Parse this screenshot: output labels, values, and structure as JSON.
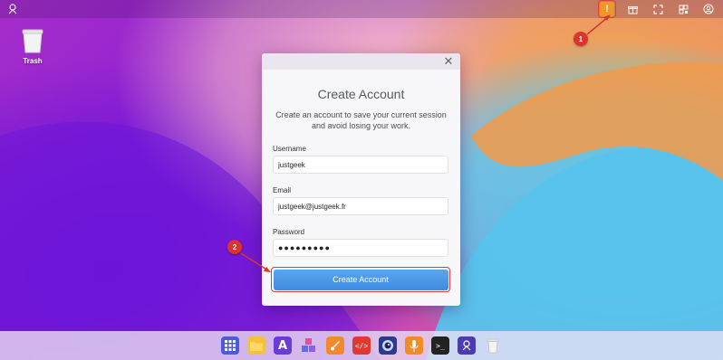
{
  "desktop": {
    "icons": [
      {
        "label": "Trash",
        "icon": "trash-icon"
      }
    ]
  },
  "topbar": {
    "left_icon": "app-logo-icon",
    "right_icons": [
      "warning-icon",
      "gift-icon",
      "fullscreen-icon",
      "qr-icon",
      "user-icon"
    ]
  },
  "dialog": {
    "title": "Create Account",
    "description": "Create an account to save your current session and avoid losing your work.",
    "fields": [
      {
        "label": "Username",
        "value": "justgeek"
      },
      {
        "label": "Email",
        "value": "justgeek@justgeek.fr"
      },
      {
        "label": "Password",
        "value": "●●●●●●●●●"
      }
    ],
    "submit_label": "Create Account"
  },
  "markers": [
    {
      "number": "1",
      "target": "warning-icon"
    },
    {
      "number": "2",
      "target": "create-account-button"
    }
  ],
  "dock": {
    "items": [
      {
        "name": "apps-grid-icon",
        "color": "#4a5bd6"
      },
      {
        "name": "files-icon",
        "color": "#f6c03b"
      },
      {
        "name": "text-editor-icon",
        "color": "#6a3bd6"
      },
      {
        "name": "cubes-icon",
        "color": "#5c6ef0"
      },
      {
        "name": "paint-icon",
        "color": "#f28a2d"
      },
      {
        "name": "code-editor-icon",
        "color": "#e0392f"
      },
      {
        "name": "camera-icon",
        "color": "#2a3b8c"
      },
      {
        "name": "microphone-icon",
        "color": "#f08c28"
      },
      {
        "name": "terminal-icon",
        "color": "#222222"
      },
      {
        "name": "puter-logo-icon",
        "color": "#4b3bb0"
      },
      {
        "name": "trash-dock-icon",
        "color": "#d9d9d9"
      }
    ]
  },
  "colors": {
    "accent_blue": "#4a97e8",
    "marker_red": "#d7362f",
    "alert_orange": "#f39a20"
  }
}
